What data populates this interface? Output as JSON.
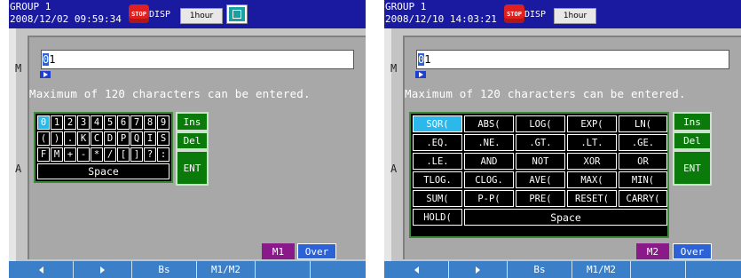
{
  "screens": [
    {
      "header": {
        "group": "GROUP 1",
        "datetime": "2008/12/02 09:59:34",
        "stop_icon": "STOP",
        "disp": "DISP",
        "interval": "1hour",
        "monitor_icon": "monitor-icon"
      },
      "side": {
        "m": "M",
        "a": "A"
      },
      "input": {
        "cursor_char": "0",
        "rest": "1"
      },
      "message": "Maximum of 120 characters can be entered.",
      "keyboard": {
        "rows": [
          [
            "0",
            "1",
            "2",
            "3",
            "4",
            "5",
            "6",
            "7",
            "8",
            "9"
          ],
          [
            "(",
            ")",
            ".",
            "K",
            "C",
            "D",
            "P",
            "Q",
            "I",
            "S"
          ],
          [
            "F",
            "M",
            "+",
            "-",
            "*",
            "/",
            "[",
            "]",
            "?",
            ":"
          ]
        ],
        "space": "Space",
        "selected": "0"
      },
      "buttons": {
        "ins": "Ins",
        "del": "Del",
        "ent": "ENT"
      },
      "mode": "M1",
      "over": "Over",
      "bottom": {
        "bs": "Bs",
        "m1m2": "M1/M2"
      }
    },
    {
      "header": {
        "group": "GROUP 1",
        "datetime": "2008/12/10 14:03:21",
        "stop_icon": "STOP",
        "disp": "DISP",
        "interval": "1hour"
      },
      "side": {
        "m": "M",
        "a": "A"
      },
      "input": {
        "cursor_char": "0",
        "rest": "1"
      },
      "message": "Maximum of 120 characters can be entered.",
      "keyboard": {
        "rows": [
          [
            "SQR(",
            "ABS(",
            "LOG(",
            "EXP(",
            "LN("
          ],
          [
            ".EQ.",
            ".NE.",
            ".GT.",
            ".LT.",
            ".GE."
          ],
          [
            ".LE.",
            "AND",
            "NOT",
            "XOR",
            "OR"
          ],
          [
            "TLOG.",
            "CLOG.",
            "AVE(",
            "MAX(",
            "MIN("
          ],
          [
            "SUM(",
            "P-P(",
            "PRE(",
            "RESET(",
            "CARRY("
          ]
        ],
        "last_key": "HOLD(",
        "space": "Space",
        "selected": "SQR("
      },
      "buttons": {
        "ins": "Ins",
        "del": "Del",
        "ent": "ENT"
      },
      "mode": "M2",
      "over": "Over",
      "bottom": {
        "bs": "Bs",
        "m1m2": "M1/M2"
      }
    }
  ],
  "colors": {
    "topbar": "#1a1aa0",
    "panel": "#a8a8a8",
    "selected_key": "#2cb8ea",
    "green_button": "#0a7a0a",
    "mode_button": "#8a1a8a",
    "over_button": "#2d62d6",
    "bottom_bar": "#3a7fc8"
  }
}
